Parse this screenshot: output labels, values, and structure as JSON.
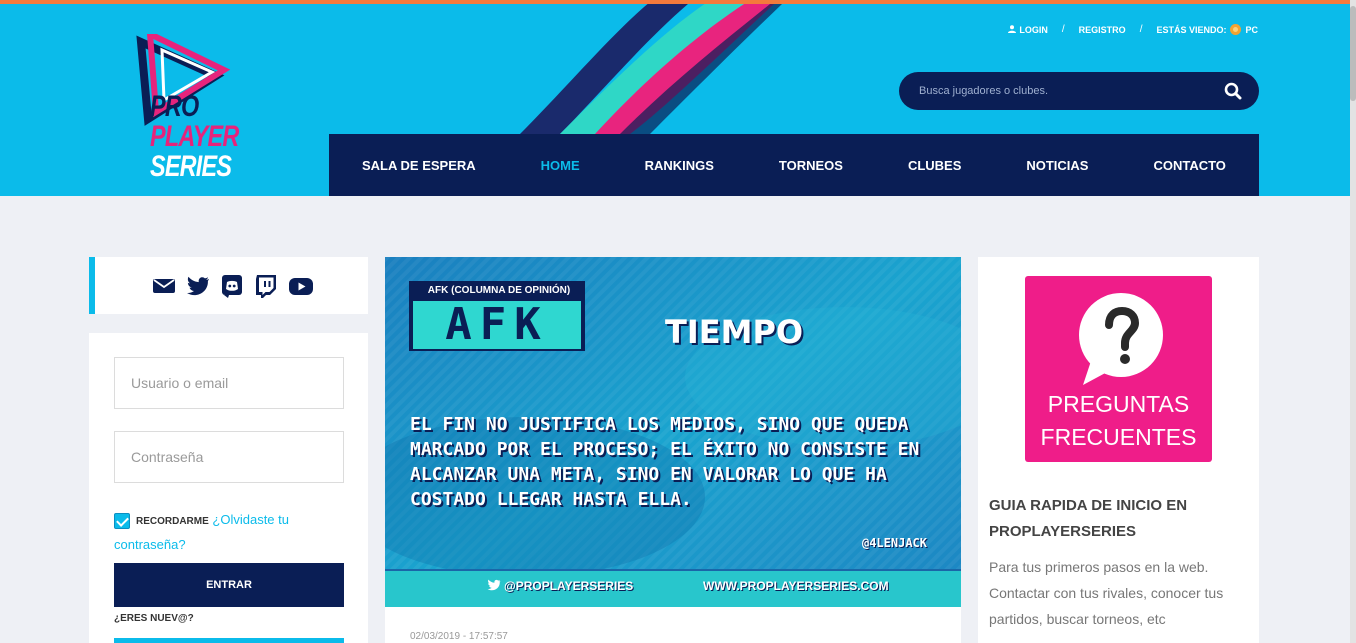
{
  "colors": {
    "accent": "#0bbbea",
    "navy": "#0a1e55",
    "brand_pink": "#e6247c",
    "faq_pink": "#ef1d89",
    "top_accent": "#f47a3c"
  },
  "header": {
    "logo": {
      "line1": "PRO",
      "line2": "PLAYER",
      "line3": "SERIES"
    },
    "top_links": {
      "login": "LOGIN",
      "register": "REGISTRO",
      "viewing_label": "ESTÁS VIENDO:",
      "platform": "PC"
    },
    "search": {
      "placeholder": "Busca jugadores o clubes."
    },
    "nav": [
      {
        "label": "SALA DE ESPERA"
      },
      {
        "label": "HOME",
        "active": true
      },
      {
        "label": "RANKINGS"
      },
      {
        "label": "TORNEOS"
      },
      {
        "label": "CLUBES"
      },
      {
        "label": "NOTICIAS"
      },
      {
        "label": "CONTACTO"
      }
    ]
  },
  "social": {
    "icons": [
      "mail-icon",
      "twitter-icon",
      "discord-icon",
      "twitch-icon",
      "youtube-icon"
    ]
  },
  "login": {
    "username_placeholder": "Usuario o email",
    "password_placeholder": "Contraseña",
    "remember_label": "RECORDARME",
    "remember_checked": true,
    "forgot_link": "¿Olvidaste tu contraseña?",
    "submit_label": "ENTRAR",
    "new_user_text": "¿ERES NUEV@?"
  },
  "post": {
    "banner": {
      "tag_label": "AFK (COLUMNA DE OPINIÓN)",
      "tag_logo": "AFK",
      "title": "TIEMPO",
      "quote": "EL FIN NO JUSTIFICA LOS MEDIOS, SINO QUE QUEDA MARCADO POR EL PROCESO; EL ÉXITO NO CONSISTE EN ALCANZAR UNA META, SINO EN VALORAR LO QUE HA COSTADO LLEGAR HASTA ELLA.",
      "author": "@4LENJACK",
      "twitter_handle": "@PROPLAYERSERIES",
      "website": "WWW.PROPLAYERSERIES.COM"
    },
    "date": "02/03/2019 - 17:57:57"
  },
  "sidebar": {
    "faq_label": "PREGUNTAS FRECUENTES",
    "guide_title": "GUIA RAPIDA DE INICIO EN PROPLAYERSERIES",
    "guide_text": "Para tus primeros pasos en la web. Contactar con tus rivales, conocer tus partidos, buscar torneos, etc"
  }
}
